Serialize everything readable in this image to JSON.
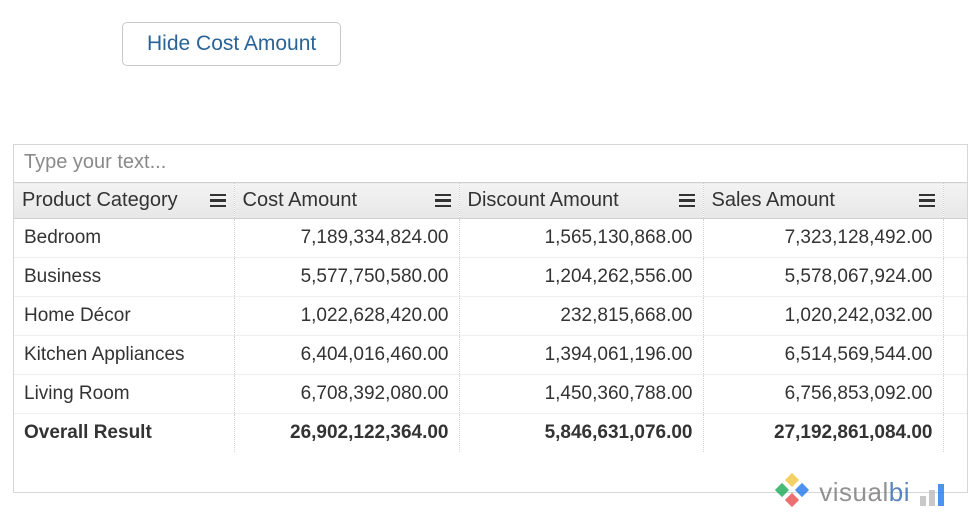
{
  "button": {
    "hide_cost_label": "Hide Cost Amount"
  },
  "search": {
    "placeholder": "Type your text..."
  },
  "table": {
    "columns": [
      {
        "label": "Product Category"
      },
      {
        "label": "Cost Amount"
      },
      {
        "label": "Discount Amount"
      },
      {
        "label": "Sales Amount"
      }
    ],
    "rows": [
      {
        "category": "Bedroom",
        "cost": "7,189,334,824.00",
        "discount": "1,565,130,868.00",
        "sales": "7,323,128,492.00"
      },
      {
        "category": "Business",
        "cost": "5,577,750,580.00",
        "discount": "1,204,262,556.00",
        "sales": "5,578,067,924.00"
      },
      {
        "category": "Home Décor",
        "cost": "1,022,628,420.00",
        "discount": "232,815,668.00",
        "sales": "1,020,242,032.00"
      },
      {
        "category": "Kitchen Appliances",
        "cost": "6,404,016,460.00",
        "discount": "1,394,061,196.00",
        "sales": "6,514,569,544.00"
      },
      {
        "category": "Living Room",
        "cost": "6,708,392,080.00",
        "discount": "1,450,360,788.00",
        "sales": "6,756,853,092.00"
      }
    ],
    "total": {
      "label": "Overall Result",
      "cost": "26,902,122,364.00",
      "discount": "5,846,631,076.00",
      "sales": "27,192,861,084.00"
    }
  },
  "watermark": {
    "brand_prefix": "visual",
    "brand_suffix": "bi"
  }
}
